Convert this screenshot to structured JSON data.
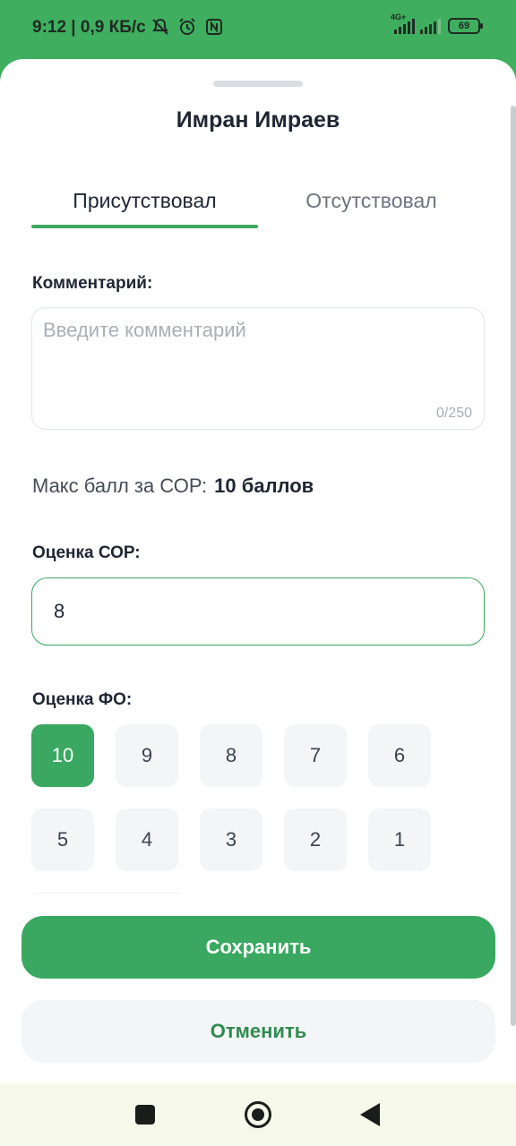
{
  "status_bar": {
    "time": "9:12 | 0,9 КБ/с",
    "network": "4G+",
    "battery": "69"
  },
  "sheet": {
    "title": "Имран Имраев",
    "tabs": [
      {
        "label": "Присутствовал",
        "selected": true
      },
      {
        "label": "Отсутствовал",
        "selected": false
      }
    ],
    "comment": {
      "label": "Комментарий:",
      "placeholder": "Введите комментарий",
      "value": "",
      "counter": "0/250"
    },
    "max_score": {
      "label": "Макс балл за СОР:",
      "value": "10 баллов"
    },
    "sor_score": {
      "label": "Оценка СОР:",
      "value": "8"
    },
    "fo_score": {
      "label": "Оценка ФО:",
      "options": [
        "10",
        "9",
        "8",
        "7",
        "6",
        "5",
        "4",
        "3",
        "2",
        "1"
      ],
      "selected": "10"
    },
    "buttons": {
      "save": "Сохранить",
      "cancel": "Отменить"
    }
  },
  "colors": {
    "accent": "#3aa860",
    "status_bar": "#3fae5f",
    "nav_bar": "#f6f9ea"
  },
  "nav": {
    "icons": [
      "recents-square-icon",
      "home-circle-icon",
      "back-triangle-icon"
    ]
  }
}
